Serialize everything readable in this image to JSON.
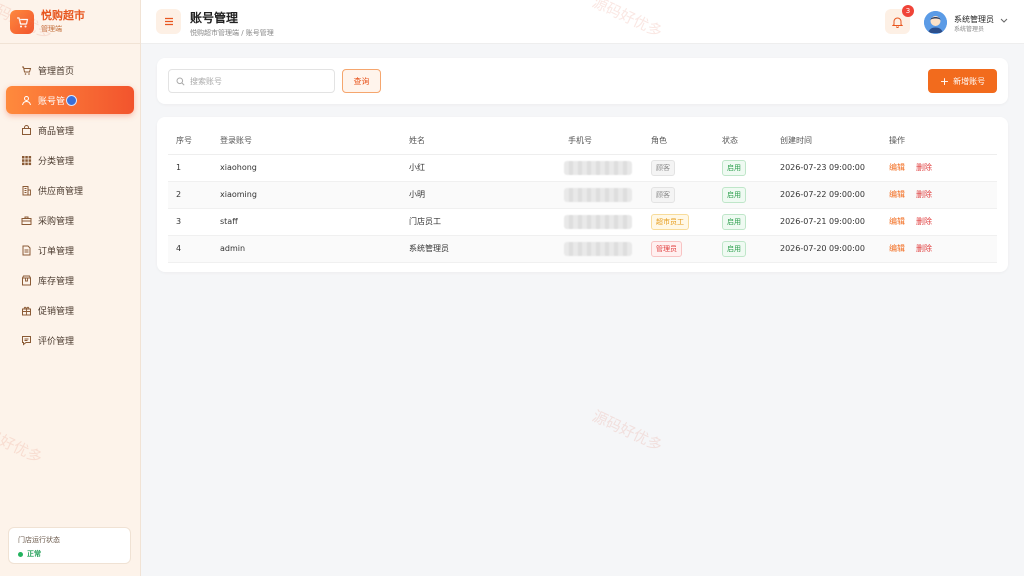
{
  "brand": {
    "title": "悦购超市",
    "subtitle": "管理端"
  },
  "sidebar": {
    "items": [
      {
        "label": "管理首页",
        "icon": "cart-icon"
      },
      {
        "label": "账号管",
        "icon": "user-icon",
        "active": true
      },
      {
        "label": "商品管理",
        "icon": "bag-icon"
      },
      {
        "label": "分类管理",
        "icon": "grid-icon"
      },
      {
        "label": "供应商管理",
        "icon": "building-icon"
      },
      {
        "label": "采购管理",
        "icon": "briefcase-icon"
      },
      {
        "label": "订单管理",
        "icon": "document-icon"
      },
      {
        "label": "库存管理",
        "icon": "box-icon"
      },
      {
        "label": "促销管理",
        "icon": "gift-icon"
      },
      {
        "label": "评价管理",
        "icon": "comment-icon"
      }
    ],
    "status_card": {
      "title": "门店运行状态",
      "value": "正常"
    }
  },
  "header": {
    "title": "账号管理",
    "breadcrumb": "悦购超市管理端 / 账号管理",
    "notification_count": "3",
    "user_name": "系统管理员",
    "user_role": "系统管理员"
  },
  "search": {
    "placeholder": "搜索账号",
    "query_label": "查询",
    "add_label": "新增账号"
  },
  "table": {
    "columns": [
      "序号",
      "登录账号",
      "姓名",
      "手机号",
      "角色",
      "状态",
      "创建时间",
      "操作"
    ],
    "rows": [
      {
        "index": "1",
        "account": "xiaohong",
        "name": "小红",
        "role": "顾客",
        "status": "启用",
        "created": "2026-07-23 09:00:00"
      },
      {
        "index": "2",
        "account": "xiaoming",
        "name": "小明",
        "role": "顾客",
        "status": "启用",
        "created": "2026-07-22 09:00:00"
      },
      {
        "index": "3",
        "account": "staff",
        "name": "门店员工",
        "role": "超市员工",
        "status": "启用",
        "created": "2026-07-21 09:00:00"
      },
      {
        "index": "4",
        "account": "admin",
        "name": "系统管理员",
        "role": "管理员",
        "status": "启用",
        "created": "2026-07-20 09:00:00"
      }
    ],
    "edit_label": "编辑",
    "delete_label": "删除"
  },
  "watermark": "源码好优多",
  "colors": {
    "accent": "#f26b1d",
    "brand": "#e8561f",
    "danger": "#e03e3e",
    "success": "#2a9d4b"
  }
}
